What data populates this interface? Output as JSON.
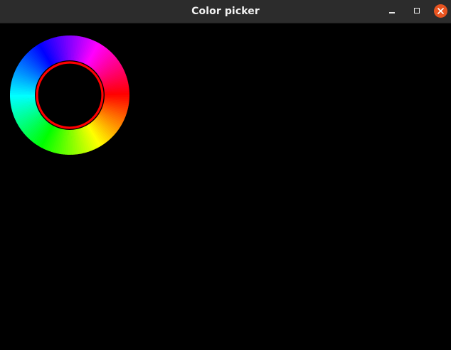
{
  "window": {
    "title": "Color picker",
    "controls": {
      "minimize_icon": "minimize-icon",
      "maximize_icon": "maximize-icon",
      "close_icon": "close-icon",
      "close_color": "#e95420"
    }
  },
  "picker": {
    "selected_color": "#ff0000",
    "selected_hue_degrees": 0
  }
}
